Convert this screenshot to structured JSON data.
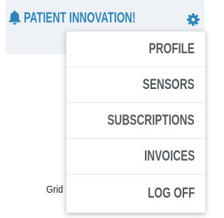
{
  "header": {
    "title": "PATIENT INNOVATION!",
    "notification_icon": "bell-icon",
    "settings_icon": "gear-icon"
  },
  "background": {
    "partial_text": "Grid"
  },
  "menu": {
    "items": [
      {
        "label": "PROFILE"
      },
      {
        "label": "SENSORS"
      },
      {
        "label": "SUBSCRIPTIONS"
      },
      {
        "label": "INVOICES"
      },
      {
        "label": "LOG OFF"
      }
    ]
  },
  "colors": {
    "accent": "#2a86bd",
    "menu_text": "#555a60",
    "header_bg": "#eef1f6"
  }
}
